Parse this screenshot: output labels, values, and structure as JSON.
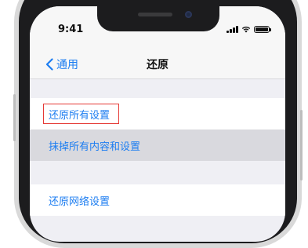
{
  "status_bar": {
    "time": "9:41",
    "icons": [
      "cellular-signal-icon",
      "wifi-icon",
      "battery-icon"
    ]
  },
  "nav": {
    "back_label": "通用",
    "title": "还原"
  },
  "rows": [
    {
      "label": "还原所有设置",
      "highlighted": true
    },
    {
      "label": "抹掉所有内容和设置",
      "pressed": true
    },
    {
      "label": "还原网络设置"
    }
  ],
  "colors": {
    "link": "#1e7ef1",
    "background": "#efeff4",
    "highlight_border": "#e53935",
    "pressed_row": "#d9d9de"
  }
}
